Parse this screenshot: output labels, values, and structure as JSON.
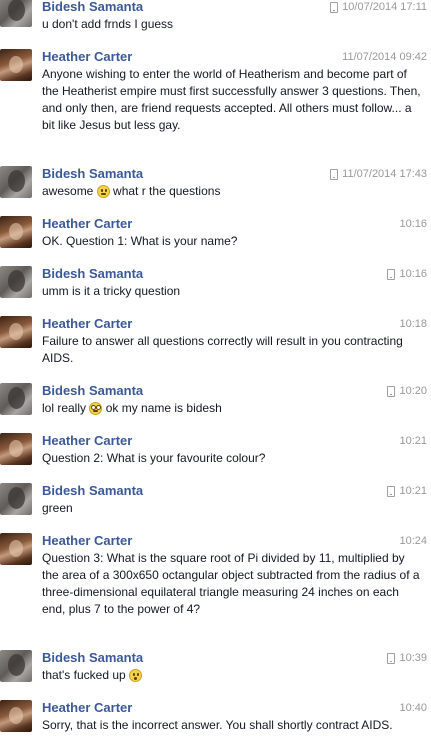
{
  "messages": [
    {
      "sender": "Bidesh Samanta",
      "who": "bidesh",
      "mobile": true,
      "time": "10/07/2014 17:11",
      "text": "u don't add frnds I guess"
    },
    {
      "sender": "Heather Carter",
      "who": "heather",
      "mobile": false,
      "time": "11/07/2014 09:42",
      "text": "Anyone wishing to enter the world of Heatherism and become part of the Heatherist empire must first successfully answer 3 questions. Then, and only then, are friend requests accepted. All others must follow... a bit like Jesus but less gay."
    },
    {
      "sender": "Bidesh Samanta",
      "who": "bidesh",
      "mobile": true,
      "time": "11/07/2014 17:43",
      "text": "awesome",
      "emoji": "smile-emoji",
      "text_after": "what r the questions"
    },
    {
      "sender": "Heather Carter",
      "who": "heather",
      "mobile": false,
      "time": "10:16",
      "text": "OK. Question 1: What is your name?"
    },
    {
      "sender": "Bidesh Samanta",
      "who": "bidesh",
      "mobile": true,
      "time": "10:16",
      "text": "umm is it a tricky question"
    },
    {
      "sender": "Heather Carter",
      "who": "heather",
      "mobile": false,
      "time": "10:18",
      "text": "Failure to answer all questions correctly will result in you contracting AIDS."
    },
    {
      "sender": "Bidesh Samanta",
      "who": "bidesh",
      "mobile": true,
      "time": "10:20",
      "text": "lol really",
      "emoji": "flushed-emoji",
      "text_after": "ok my name is bidesh"
    },
    {
      "sender": "Heather Carter",
      "who": "heather",
      "mobile": false,
      "time": "10:21",
      "text": "Question 2: What is your favourite colour?"
    },
    {
      "sender": "Bidesh Samanta",
      "who": "bidesh",
      "mobile": true,
      "time": "10:21",
      "text": "green"
    },
    {
      "sender": "Heather Carter",
      "who": "heather",
      "mobile": false,
      "time": "10:24",
      "text": "Question 3: What is the square root of Pi divided by 11, multiplied by the area of a 300x650 octangular object subtracted from the radius of a three-dimensional equilateral triangle measuring 24 inches on each end, plus 7 to the power of 4?"
    },
    {
      "sender": "Bidesh Samanta",
      "who": "bidesh",
      "mobile": true,
      "time": "10:39",
      "text": "that's fucked up",
      "emoji": "shocked-emoji",
      "text_after": ""
    },
    {
      "sender": "Heather Carter",
      "who": "heather",
      "mobile": false,
      "time": "10:40",
      "text": "Sorry, that is the incorrect answer. You shall shortly contract AIDS."
    }
  ],
  "colors": {
    "name": "#3b5998",
    "text": "#141823",
    "meta": "#999999"
  }
}
